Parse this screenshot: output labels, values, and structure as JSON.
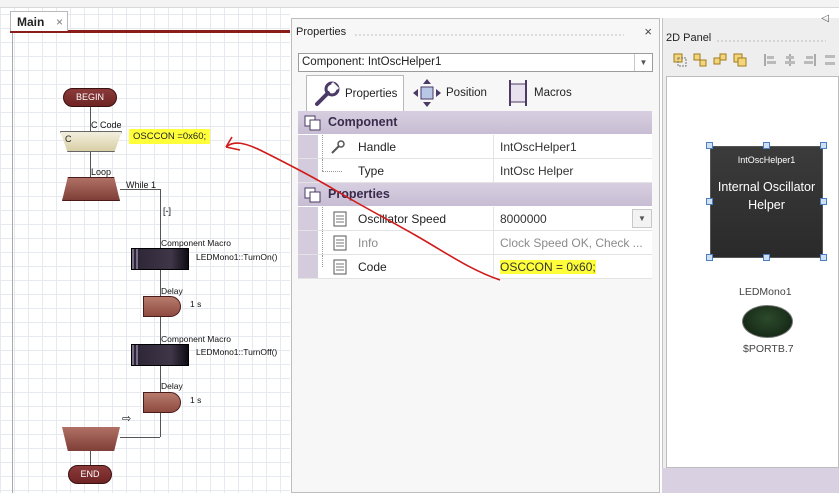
{
  "editor": {
    "tab_main": "Main",
    "tab_close": "×"
  },
  "flowchart": {
    "begin": "BEGIN",
    "end": "END",
    "ccode_caption": "C Code",
    "ccode_block": "C",
    "ccode_text": "OSCCON =0x60;",
    "loop_caption": "Loop",
    "loop_condition": "While 1",
    "collapse": "[-]",
    "macro1_caption": "Component Macro",
    "macro1_text": "LEDMono1::TurnOn()",
    "delay1_caption": "Delay",
    "delay1_value": "1 s",
    "macro2_caption": "Component Macro",
    "macro2_text": "LEDMono1::TurnOff()",
    "delay2_caption": "Delay",
    "delay2_value": "1 s",
    "arrow_marker": "⇨"
  },
  "properties": {
    "title": "Properties",
    "close": "×",
    "component_select": "Component: IntOscHelper1",
    "tabs": [
      "Properties",
      "Position",
      "Macros"
    ],
    "section_component": "Component",
    "section_properties": "Properties",
    "rows_component": [
      {
        "name": "Handle",
        "value": "IntOscHelper1"
      },
      {
        "name": "Type",
        "value": "IntOsc Helper"
      }
    ],
    "rows_properties": [
      {
        "name": "Oscillator Speed",
        "value": "8000000"
      },
      {
        "name": "Info",
        "value": "Clock Speed OK, Check ..."
      },
      {
        "name": "Code",
        "value": "OSCCON = 0x60;"
      }
    ],
    "highlight_color": "#ffff3a",
    "section_color": "#d7cfe0"
  },
  "panel2d": {
    "title": "2D Panel",
    "component_label": "IntOscHelper1",
    "component_body": "Internal Oscillator Helper",
    "led_label": "LEDMono1",
    "led_port": "$PORTB.7"
  },
  "annotation": {
    "color": "#d11a1a"
  }
}
